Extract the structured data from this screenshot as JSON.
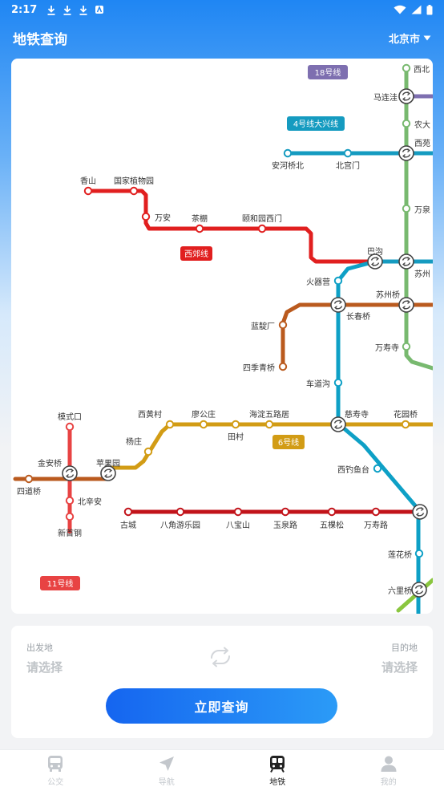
{
  "status_bar": {
    "time": "2:17"
  },
  "header": {
    "title": "地铁查询",
    "city": "北京市"
  },
  "colors": {
    "line4": "#159bc0",
    "line6": "#d29c15",
    "line10": "#0ea0c6",
    "line11": "#e84343",
    "line18": "#7e6fb0",
    "xijiao": "#e11f1f",
    "line1": "#c2131a",
    "line9": "#8ac63f",
    "fangshan": "#ba5a1e",
    "green": "#78b96f"
  },
  "map": {
    "line_badges": {
      "line18": "18号线",
      "line4_daxing": "4号线大兴线",
      "xijiao": "西郊线",
      "line6": "6号线",
      "line11": "11号线"
    },
    "stations": {
      "xiyuan_top": "西北",
      "malianwa": "马连洼",
      "nongda": "农大",
      "xier": "西苑",
      "anheqiaobei": "安河桥北",
      "beigongmen": "北宫门",
      "wanquan": "万泉",
      "xiangshan": "香山",
      "zhiwuyuan": "国家植物园",
      "wanan": "万安",
      "chapeng": "茶棚",
      "yiheyuan": "颐和园西门",
      "bagou": "巴沟",
      "suzhoujie": "苏州",
      "huoqiying": "火器营",
      "suzhouqiao": "苏州桥",
      "changchunqiao": "长春桥",
      "landianchang": "蓝靛厂",
      "wanshousi": "万寿寺",
      "siji": "四季青桥",
      "chedaogou": "车道沟",
      "xihuangcun": "西黄村",
      "liaogongzhuang": "廖公庄",
      "haidianwulu": "海淀五路居",
      "tiancun": "田村",
      "cishousi": "慈寿寺",
      "huayuanqiao": "花园桥",
      "moshikou": "模式口",
      "yangzhuang": "杨庄",
      "pingguoyuan": "苹果园",
      "jinanqiao": "金安桥",
      "sidaoqiao": "四道桥",
      "beixinan": "北辛安",
      "xinshougang": "新首钢",
      "xidiaoyutai": "西钓鱼台",
      "gucheng": "古城",
      "bajiao": "八角游乐园",
      "babaoshan": "八宝山",
      "yuquanlu": "玉泉路",
      "wukesong": "五棵松",
      "wanshoulu": "万寿路",
      "lianhuaqiao": "莲花桥",
      "liuliqiao": "六里桥"
    }
  },
  "query": {
    "from_label": "出发地",
    "from_placeholder": "请选择",
    "to_label": "目的地",
    "to_placeholder": "请选择",
    "button": "立即查询"
  },
  "tabs": [
    {
      "label": "公交",
      "icon": "bus-icon",
      "active": false
    },
    {
      "label": "导航",
      "icon": "navigation-icon",
      "active": false
    },
    {
      "label": "地铁",
      "icon": "subway-icon",
      "active": true
    },
    {
      "label": "我的",
      "icon": "user-icon",
      "active": false
    }
  ]
}
